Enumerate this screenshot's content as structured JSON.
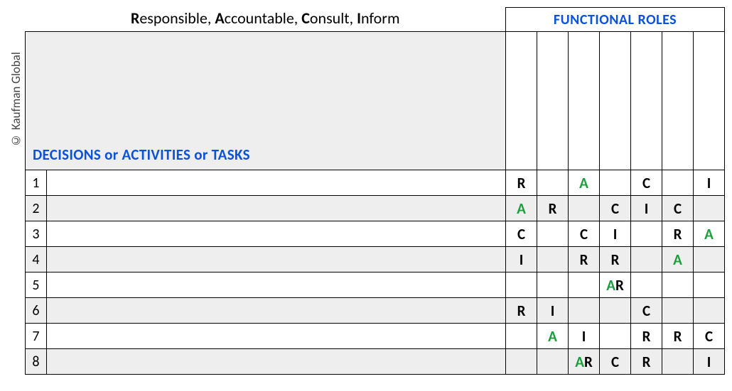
{
  "copyright": "© Kaufman Global",
  "title_parts": {
    "r": "R",
    "r_rest": "esponsible, ",
    "a": "A",
    "a_rest": "ccountable, ",
    "c": "C",
    "c_rest": "onsult, ",
    "i": "I",
    "i_rest": "nform"
  },
  "functional_roles_header": "FUNCTIONAL ROLES",
  "decisions_label": "DECISIONS or ACTIVITIES or TASKS",
  "role_columns": [
    "",
    "",
    "",
    "",
    "",
    "",
    ""
  ],
  "rows": [
    {
      "num": "1",
      "task": "",
      "cells": [
        [
          [
            "R",
            "b"
          ]
        ],
        [],
        [
          [
            "A",
            "g"
          ]
        ],
        [],
        [
          [
            "C",
            "b"
          ]
        ],
        [],
        [
          [
            "I",
            "b"
          ]
        ]
      ]
    },
    {
      "num": "2",
      "task": "",
      "cells": [
        [
          [
            "A",
            "g"
          ]
        ],
        [
          [
            "R",
            "b"
          ]
        ],
        [],
        [
          [
            "C",
            "b"
          ]
        ],
        [
          [
            "I",
            "b"
          ]
        ],
        [
          [
            "C",
            "b"
          ]
        ],
        []
      ]
    },
    {
      "num": "3",
      "task": "",
      "cells": [
        [
          [
            "C",
            "b"
          ]
        ],
        [],
        [
          [
            "C",
            "b"
          ]
        ],
        [
          [
            "I",
            "b"
          ]
        ],
        [],
        [
          [
            "R",
            "b"
          ]
        ],
        [
          [
            "A",
            "g"
          ]
        ]
      ]
    },
    {
      "num": "4",
      "task": "",
      "cells": [
        [
          [
            "I",
            "b"
          ]
        ],
        [],
        [
          [
            "R",
            "b"
          ]
        ],
        [
          [
            "R",
            "b"
          ]
        ],
        [],
        [
          [
            "A",
            "g"
          ]
        ],
        []
      ]
    },
    {
      "num": "5",
      "task": "",
      "cells": [
        [],
        [],
        [],
        [
          [
            "A",
            "g"
          ],
          [
            "R",
            "b"
          ]
        ],
        [],
        [],
        []
      ]
    },
    {
      "num": "6",
      "task": "",
      "cells": [
        [
          [
            "R",
            "b"
          ]
        ],
        [
          [
            "I",
            "b"
          ]
        ],
        [],
        [],
        [
          [
            "C",
            "b"
          ]
        ],
        [],
        []
      ]
    },
    {
      "num": "7",
      "task": "",
      "cells": [
        [],
        [
          [
            "A",
            "g"
          ]
        ],
        [
          [
            "I",
            "b"
          ]
        ],
        [],
        [
          [
            "R",
            "b"
          ]
        ],
        [
          [
            "R",
            "b"
          ]
        ],
        [
          [
            "C",
            "b"
          ]
        ]
      ]
    },
    {
      "num": "8",
      "task": "",
      "cells": [
        [],
        [],
        [
          [
            "A",
            "g"
          ],
          [
            "R",
            "b"
          ]
        ],
        [
          [
            "C",
            "b"
          ]
        ],
        [
          [
            "R",
            "b"
          ]
        ],
        [],
        [
          [
            "I",
            "b"
          ]
        ]
      ]
    }
  ]
}
